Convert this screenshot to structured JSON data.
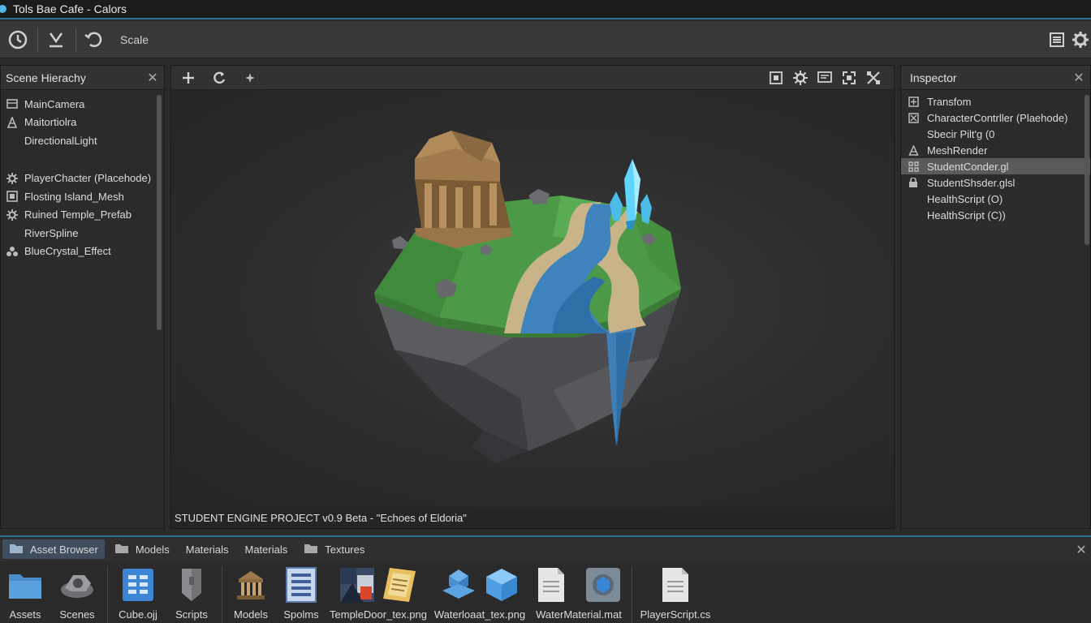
{
  "window": {
    "title": "Tols Bae Cafe - Calors"
  },
  "toolbar": {
    "scale_label": "Scale"
  },
  "hierarchy": {
    "title": "Scene Hierachy",
    "items": [
      {
        "label": "MainCamera",
        "icon": "camera-icon"
      },
      {
        "label": "Maitortiolra",
        "icon": "light-icon"
      },
      {
        "label": "DirectionalLight",
        "icon": ""
      },
      {
        "label": "PlayerChacter (Placehode)",
        "icon": "gear-icon"
      },
      {
        "label": "Flosting Island_Mesh",
        "icon": "mesh-icon"
      },
      {
        "label": "Ruined Temple_Prefab",
        "icon": "gear-icon"
      },
      {
        "label": "RiverSpline",
        "icon": ""
      },
      {
        "label": "BlueCrystal_Effect",
        "icon": "particles-icon"
      }
    ]
  },
  "scene": {
    "footer": "STUDENT ENGINE PROJECT v0.9 Beta - \"Echoes of Eldoria\""
  },
  "inspector": {
    "title": "Inspector",
    "items": [
      {
        "label": "Transfom",
        "icon": "component-icon",
        "selected": false
      },
      {
        "label": "CharacterContrller (Plaehode)",
        "icon": "component-icon",
        "selected": false
      },
      {
        "label": "Sbecir Pilt'g (0",
        "icon": "",
        "selected": false
      },
      {
        "label": "MeshRender",
        "icon": "mesh-renderer-icon",
        "selected": false
      },
      {
        "label": "StudentConder.gl",
        "icon": "shader-icon",
        "selected": true
      },
      {
        "label": "StudentShsder.glsl",
        "icon": "lock-icon",
        "selected": false
      },
      {
        "label": "HealthScript (O)",
        "icon": "",
        "selected": false
      },
      {
        "label": "HealthScript (C))",
        "icon": "",
        "selected": false
      }
    ]
  },
  "asset_browser": {
    "tabs": [
      {
        "label": "Asset Browser",
        "active": true,
        "folder": true
      },
      {
        "label": "Models",
        "active": false,
        "folder": true
      },
      {
        "label": "Materials",
        "active": false,
        "folder": false
      },
      {
        "label": "Materials",
        "active": false,
        "folder": false
      },
      {
        "label": "Textures",
        "active": false,
        "folder": true
      }
    ],
    "assets": [
      {
        "label": "Assets",
        "icon": "folder-icon"
      },
      {
        "label": "Scenes",
        "icon": "scenes-icon"
      },
      {
        "label": "Cube.ojj",
        "icon": "cube-file-icon"
      },
      {
        "label": "Scripts",
        "icon": "scripts-icon"
      },
      {
        "label": "Models",
        "icon": "models-icon"
      },
      {
        "label": "Spolms",
        "icon": "document-list-icon"
      },
      {
        "label": "TempleDoor_tex.png",
        "icon": "texture-icon"
      },
      {
        "label": "Waterloaat_tex.png",
        "icon": "water-texture-icon"
      },
      {
        "label": "WaterMaterial.mat",
        "icon": "material-icon"
      },
      {
        "label": "PlayerScript.cs",
        "icon": "script-file-icon"
      }
    ]
  }
}
